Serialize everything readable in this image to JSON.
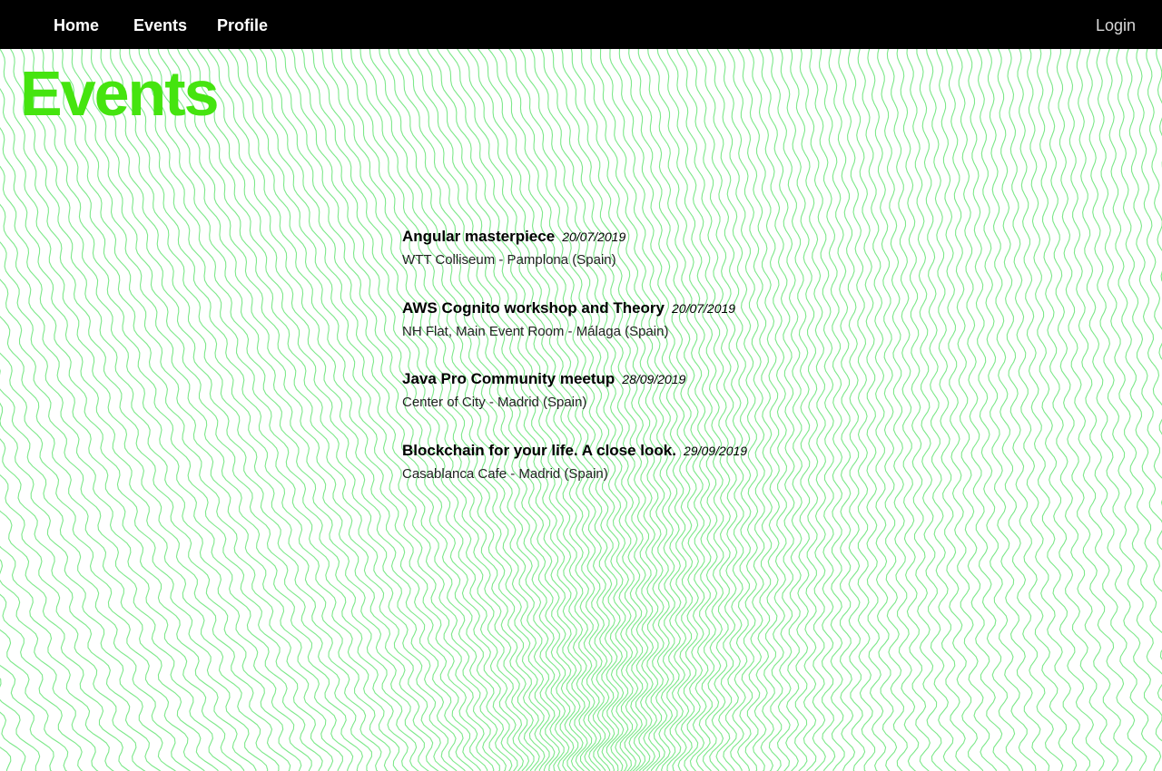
{
  "nav": {
    "home_label": "Home",
    "events_label": "Events",
    "profile_label": "Profile",
    "login_label": "Login"
  },
  "page": {
    "title": "Events",
    "accent_color": "#45e40f",
    "pattern_color": "#7de88a",
    "nav_background": "#000000"
  },
  "events": [
    {
      "title": "Angular masterpiece",
      "date": "20/07/2019",
      "venue": "WTT Colliseum - Pamplona (Spain)"
    },
    {
      "title": "AWS Cognito workshop and Theory",
      "date": "20/07/2019",
      "venue": "NH Flat, Main Event Room - Málaga (Spain)"
    },
    {
      "title": "Java Pro Community meetup",
      "date": "28/09/2019",
      "venue": "Center of City - Madrid (Spain)"
    },
    {
      "title": "Blockchain for your life. A close look.",
      "date": "29/09/2019",
      "venue": "Casablanca Cafe - Madrid (Spain)"
    }
  ]
}
